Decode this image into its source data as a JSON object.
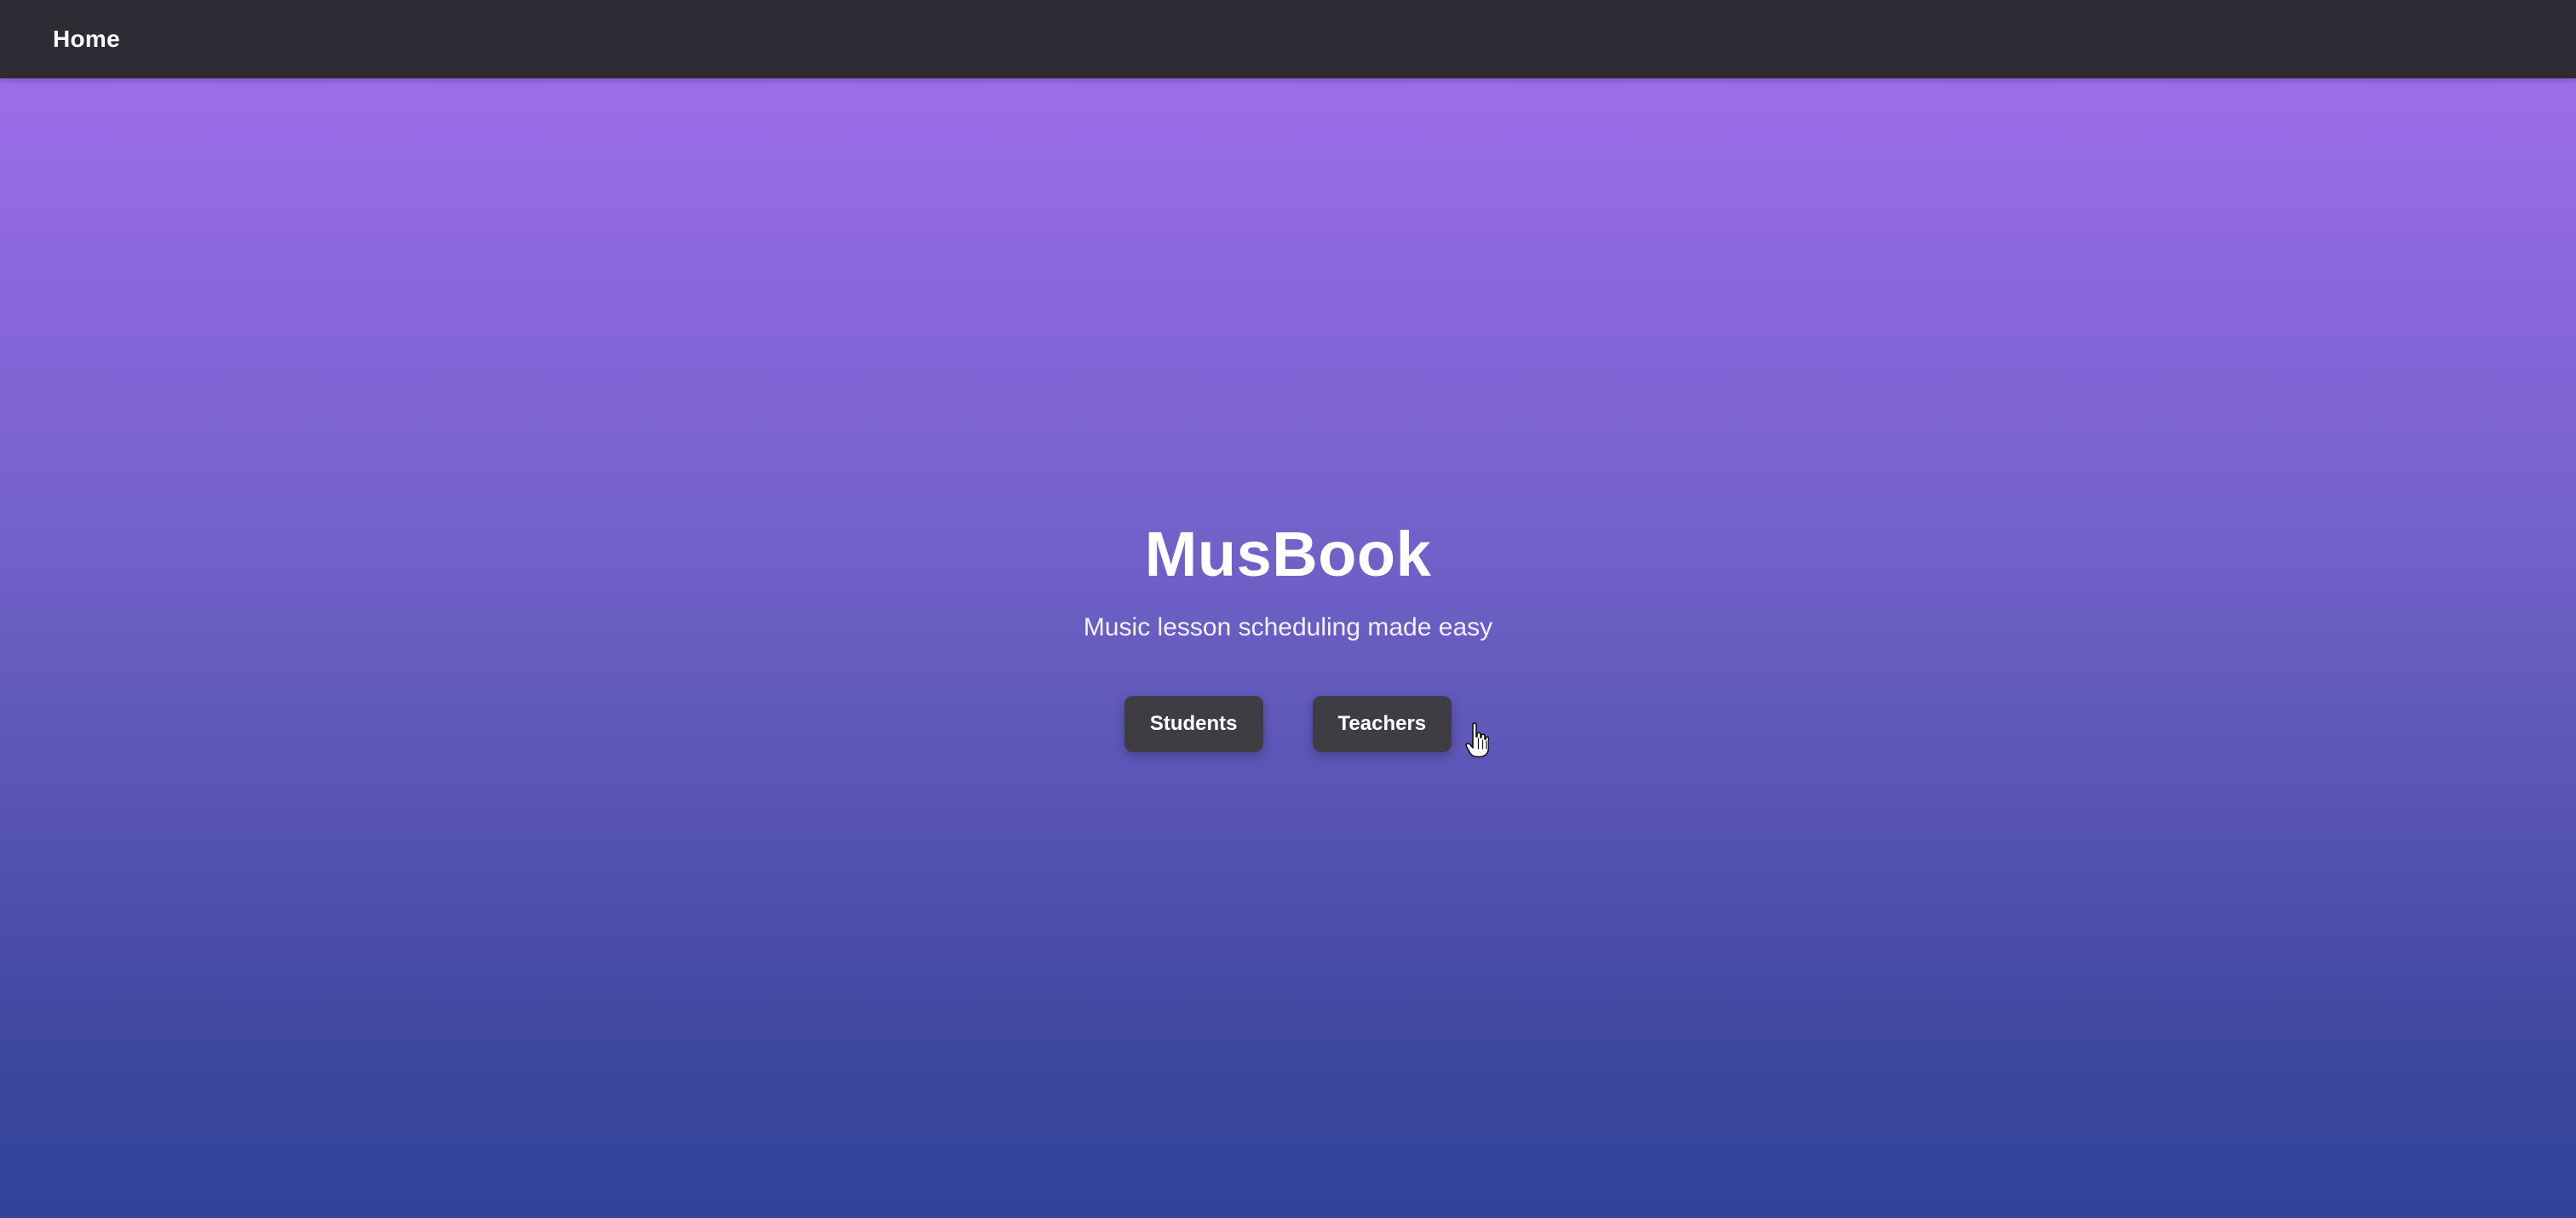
{
  "navbar": {
    "home_label": "Home",
    "background_color": "#2f2b34"
  },
  "hero": {
    "title": "MusBook",
    "subtitle": "Music lesson scheduling made easy",
    "gradient_top_color": "#a472ef",
    "gradient_bottom_color": "#31449a"
  },
  "actions": {
    "students_label": "Students",
    "teachers_label": "Teachers",
    "button_color": "#3e3d43"
  },
  "cursor": {
    "icon": "hand-pointer-icon"
  }
}
